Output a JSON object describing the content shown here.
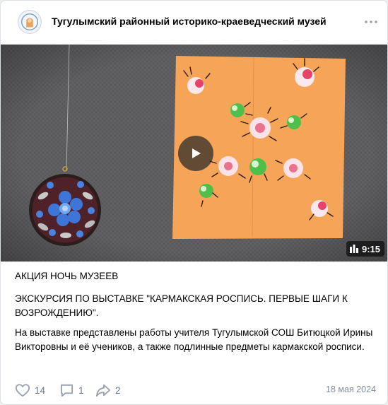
{
  "group": {
    "name": "Тугулымский районный историко-краеведческий музей"
  },
  "video": {
    "duration": "9:15"
  },
  "post": {
    "heading": "АКЦИЯ НОЧЬ МУЗЕЕВ",
    "subheading": "ЭКСКУРСИЯ ПО ВЫСТАВКЕ \"КАРМАКСКАЯ РОСПИСЬ. ПЕРВЫЕ ШАГИ К ВОЗРОЖДЕНИЮ\".",
    "body": "На выставке представлены работы учителя Тугулымской СОШ Битюцкой Ирины Викторовны и её учеников, а также подлинные предметы кармакской росписи."
  },
  "actions": {
    "likes": "14",
    "comments": "1",
    "shares": "2"
  },
  "date": "18 мая 2024",
  "icons": {
    "like": "heart-icon",
    "comment": "comment-icon",
    "share": "share-icon",
    "more": "more-dots-icon",
    "play": "play-icon",
    "video_indicator": "video-icon"
  },
  "colors": {
    "icon_gray": "#99a2ad",
    "text_secondary": "#818c99",
    "paper_orange": "#f6a458"
  }
}
